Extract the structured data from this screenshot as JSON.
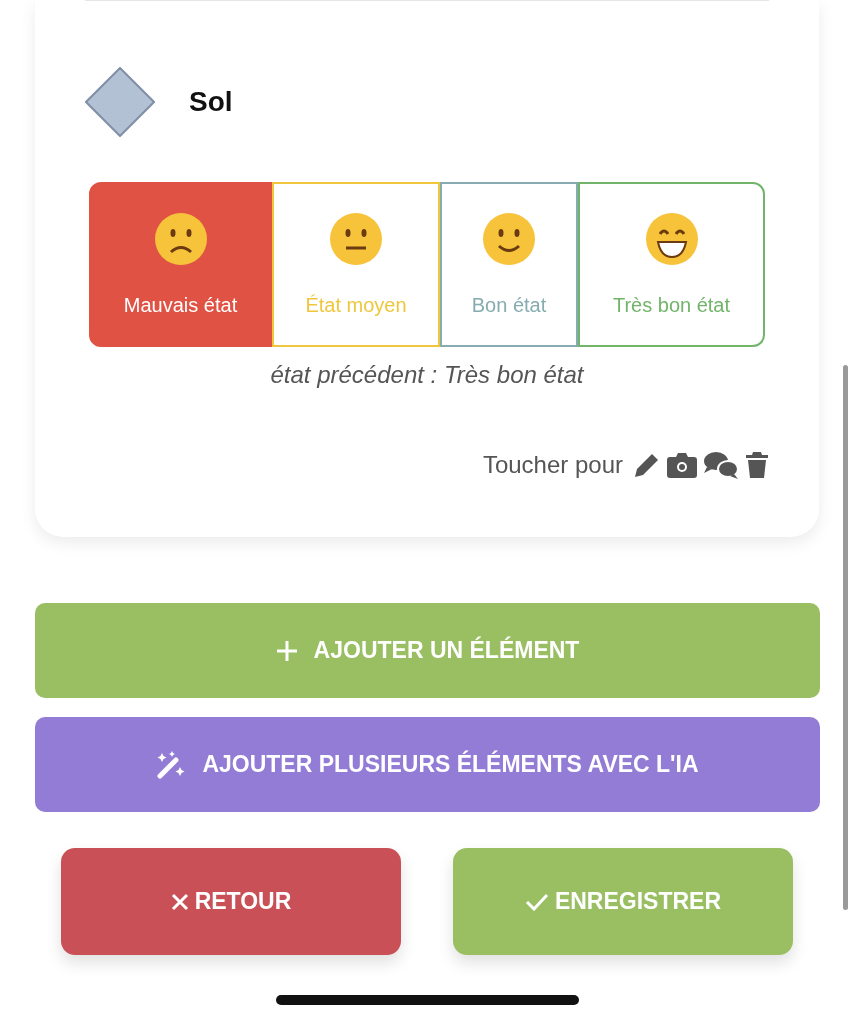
{
  "element": {
    "name": "Sol",
    "color": "#b3c1d5"
  },
  "conditions": [
    {
      "kind": "worried",
      "label": "Mauvais état",
      "color": "#e05243",
      "selected": true
    },
    {
      "kind": "neutral",
      "label": "État moyen",
      "color": "#f0c73c",
      "selected": false
    },
    {
      "kind": "smile",
      "label": "Bon état",
      "color": "#86abb0",
      "selected": false
    },
    {
      "kind": "grin",
      "label": "Très bon état",
      "color": "#72b56a",
      "selected": false
    }
  ],
  "previous_state": "état précédent : Très bon état",
  "hint": "Toucher pour",
  "buttons": [
    {
      "kind": "add",
      "label": "AJOUTER UN ÉLÉMENT",
      "color": "#99bf62"
    },
    {
      "kind": "ai",
      "label": "AJOUTER PLUSIEURS ÉLÉMENTS AVEC L'IA",
      "color": "#937cd6"
    }
  ],
  "footer": [
    {
      "kind": "back",
      "label": "RETOUR",
      "color": "#c85056"
    },
    {
      "kind": "save",
      "label": "ENREGISTRER",
      "color": "#99bf62"
    }
  ]
}
